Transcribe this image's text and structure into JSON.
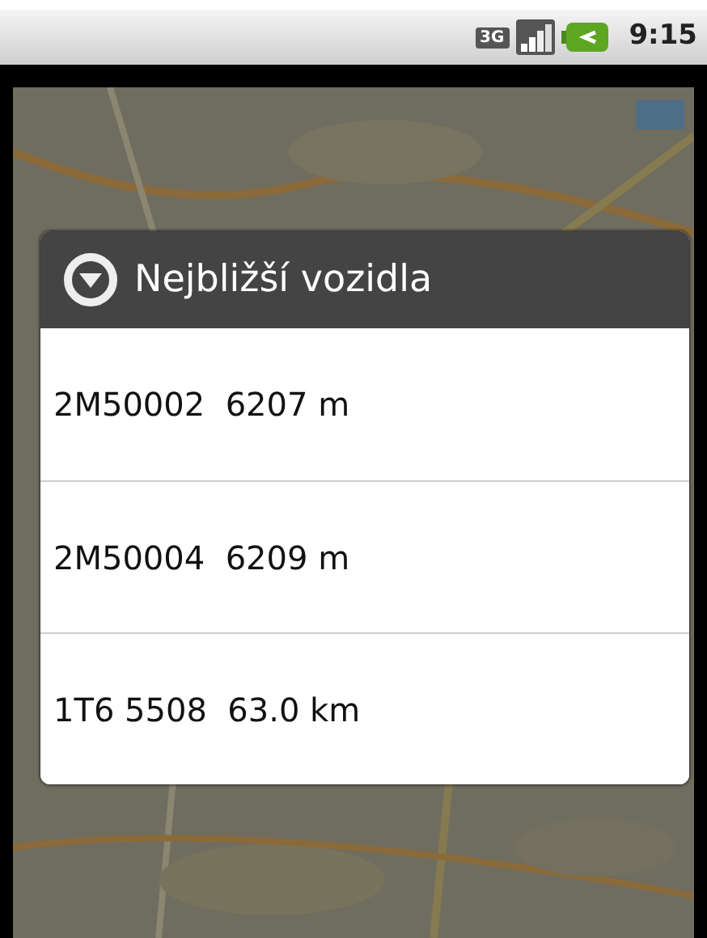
{
  "status_bar": {
    "network_type": "3G",
    "time": "9:15"
  },
  "dialog": {
    "title": "Nejbližší vozidla",
    "items": [
      {
        "vehicle": "2M50002",
        "distance": "6207 m"
      },
      {
        "vehicle": "2M50004",
        "distance": "6209 m"
      },
      {
        "vehicle": "1T6 5508",
        "distance": "63.0 km"
      }
    ]
  }
}
